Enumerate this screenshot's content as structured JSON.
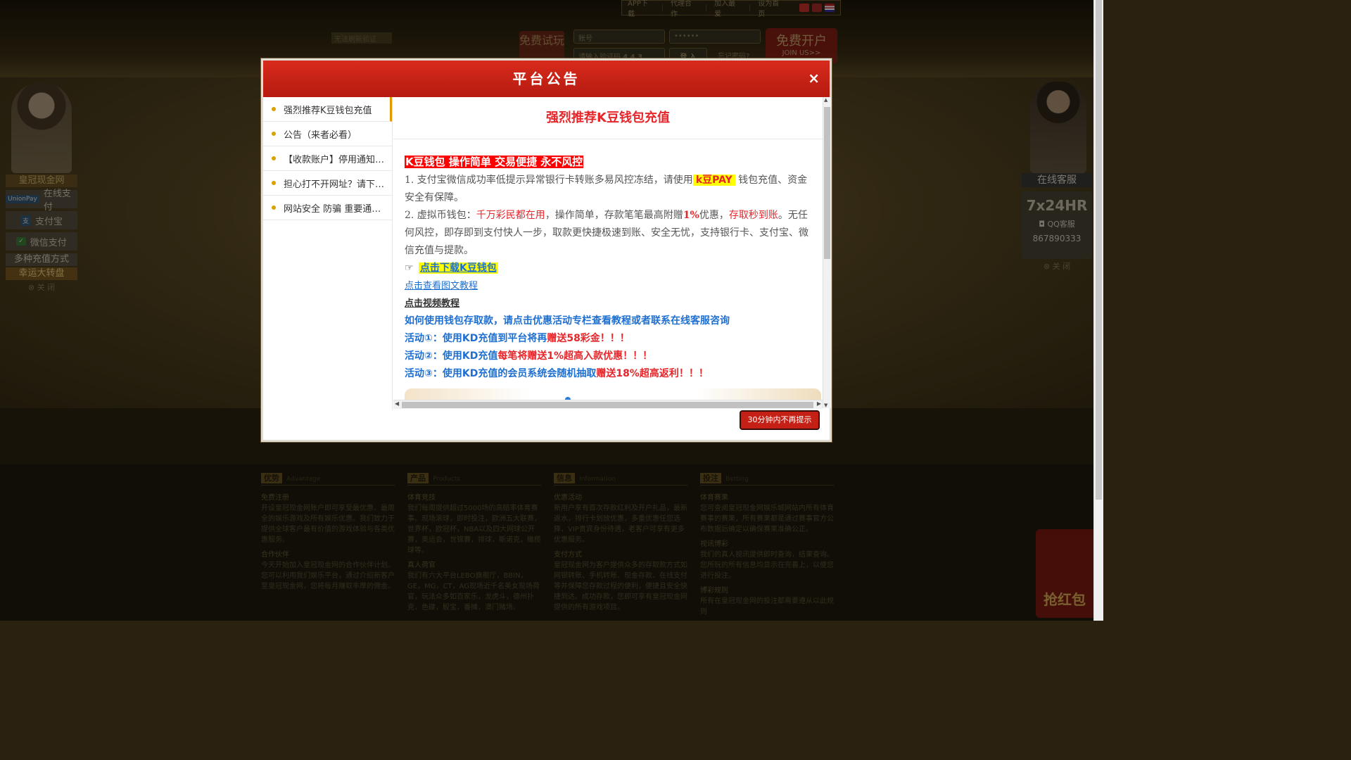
{
  "site": {
    "top_nav": [
      "APP下载",
      "代理合作",
      "加入最爱",
      "设为首页"
    ],
    "trial_button": "免费试玩",
    "account_placeholder": "账号",
    "password_placeholder": "••••••",
    "captcha_placeholder": "请输入验证码",
    "captcha_value": "4 4 3",
    "login_button": "登 入",
    "forgot_link": "忘记密码?",
    "register_button": "免费开户",
    "register_sub": "JOIN US>>",
    "no_captcha": "无法刷新验证",
    "left_panel": {
      "title": "皇冠现金网",
      "items": [
        "在线支付",
        "支付宝",
        "微信支付",
        "多种充值方式",
        "幸运大转盘"
      ],
      "close": "⊗ 关 闭"
    },
    "right_panel": {
      "title": "在线客服",
      "hours": "7x24HR",
      "qq_label": "QQ客服",
      "qq_number": "867890333",
      "close": "⊗ 关 闭"
    },
    "red_packet": "抢红包",
    "footer": [
      {
        "head": "优势",
        "en": "Advantage",
        "sections": [
          {
            "title": "免费注册",
            "text": "开设皇冠现金网账户即可享受最优惠、最周全的娱乐游戏及所有娱乐优惠。我们致力于提供全球客户最有价值的游戏体验与各类优惠服务。"
          },
          {
            "title": "合作伙伴",
            "text": "今天开始加入皇冠现金网的合作伙伴计划。您可以利用我们娱乐平台，通过介绍新客户至皇冠现金网，您将每月赚取丰厚的佣金。"
          }
        ]
      },
      {
        "head": "产品",
        "en": "Products",
        "sections": [
          {
            "title": "体育竞技",
            "text": "我们每周提供超过5000场的高赔率体育赛事。现场滚球，即时投注，欧洲五大联赛，世界杯，欧冠杯，NBA以及四大网球公开赛，奥运会，世锦赛，排球，斯诺克，橄榄球等。"
          },
          {
            "title": "真人荷官",
            "text": "我们有六大平台LEBO旗舰厅，BBIN，GE，MG，CT，AG现场近千名美女现场荷官，玩法众多如百家乐，龙虎斗，德州扑克，色碟，骰宝，番摊，澳门赌场。"
          }
        ]
      },
      {
        "head": "信息",
        "en": "Information",
        "sections": [
          {
            "title": "优惠活动",
            "text": "新用户享有首次存款红利及开户礼品，最新返水，排行卡划放优惠，多重优惠任您选择，VIP贵宾身份待遇，老客户可享有更多优惠服务。"
          },
          {
            "title": "支付方式",
            "text": "皇冠现金网为客户提供众多的存取款方式如网银转账、手机转账、现金存款、在线支付等并保障您存款过程的便利，便捷且安全快捷到达。成功存款，您即可享有皇冠现金网提供的所有游戏项目。"
          }
        ]
      },
      {
        "head": "投注",
        "en": "Betting",
        "sections": [
          {
            "title": "体育赛果",
            "text": "您可查阅皇冠现金网娱乐城网站内所有体育赛事的赛果，所有赛果都是通过赛事官方公布数据后确定以确保赛果准确公正。"
          },
          {
            "title": "视讯博彩",
            "text": "我们的真人视讯提供即时查询，结果查询。您所玩的所有信息均显示在完善上，以便您进行投注。"
          },
          {
            "title": "博彩规则",
            "text": "所有在皇冠现金网的投注都需要遵从以此规则"
          }
        ]
      }
    ]
  },
  "modal": {
    "title": "平台公告",
    "close_icon": "×",
    "nav_items": [
      "强烈推荐K豆钱包充值",
      "公告（来者必看）",
      "【收款账户】停用通知(必看)",
      "担心打不开网址？请下载APP",
      "网站安全 防骗 重要通知公告"
    ],
    "active_index": 0,
    "article": {
      "heading": "强烈推荐K豆钱包充值",
      "banner": "K豆钱包 操作简单 交易便捷 永不风控",
      "p1_a": "1.  支付宝微信成功率低提示异常银行卡转账多易风控冻结，请使用",
      "p1_kpay": "k豆PAY",
      "p1_b": " 钱包充值、资金安全有保障。",
      "p2_a": "2.  虚拟币钱包：",
      "p2_red1": "千万彩民都在用",
      "p2_b": "，操作简单，存款笔笔最高附赠",
      "p2_pct": "1%",
      "p2_c": "优惠，",
      "p2_red2": "存取秒到账",
      "p2_d": "。无任何风控，即存即到支付快人一步，取款更快捷极速到账、安全无忧，支持银行卡、支付宝、微信充值与提款。",
      "download_link": "点击下载K豆钱包",
      "tutorial_link": "点击查看图文教程",
      "video_link": "点击视频教程",
      "how_to": "如何使用钱包存取款，请点击优惠活动专栏查看教程或者联系在线客服咨询",
      "activity1_a": "活动①：使用KD充值到平台将再",
      "activity1_b": "赠送58彩金！！！",
      "activity2_a": "活动②：使用KD充值",
      "activity2_b": "每笔将赠送1%超高入款优惠！！！",
      "activity3_a": "活动③：使用KD充值的会员系统会随机抽取",
      "activity3_b": "赠送18%超高返利！！！"
    },
    "dismiss_button": "30分钟内不再提示"
  },
  "colors": {
    "header_red": "#d82b1d",
    "title_red": "#e6262a",
    "link_blue": "#1f6fd0",
    "highlight_yellow": "#ffff00",
    "nav_dot": "#d9a200"
  }
}
